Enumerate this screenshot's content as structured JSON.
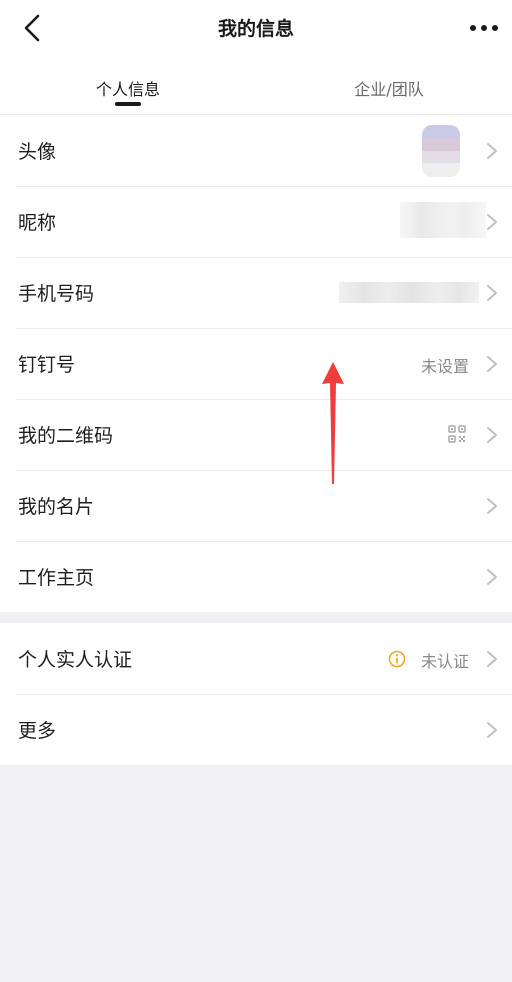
{
  "header": {
    "title": "我的信息",
    "back_icon": "chevron-left-icon",
    "more_icon": "ellipsis-icon"
  },
  "tabs": [
    {
      "label": "个人信息",
      "active": true
    },
    {
      "label": "企业/团队",
      "active": false
    }
  ],
  "rows": {
    "avatar": {
      "label": "头像"
    },
    "nickname": {
      "label": "昵称"
    },
    "phone": {
      "label": "手机号码"
    },
    "dingtalk_id": {
      "label": "钉钉号",
      "value": "未设置"
    },
    "qr_code": {
      "label": "我的二维码",
      "icon": "qr-code-icon"
    },
    "business_card": {
      "label": "我的名片"
    },
    "work_homepage": {
      "label": "工作主页"
    },
    "verification": {
      "label": "个人实人认证",
      "value": "未认证",
      "icon": "info-circle-icon"
    },
    "more": {
      "label": "更多"
    }
  },
  "colors": {
    "background": "#efeff4",
    "surface": "#ffffff",
    "warning": "#f5a623",
    "annotation": "#f03c3c",
    "secondary_text": "#8a8a8a"
  }
}
